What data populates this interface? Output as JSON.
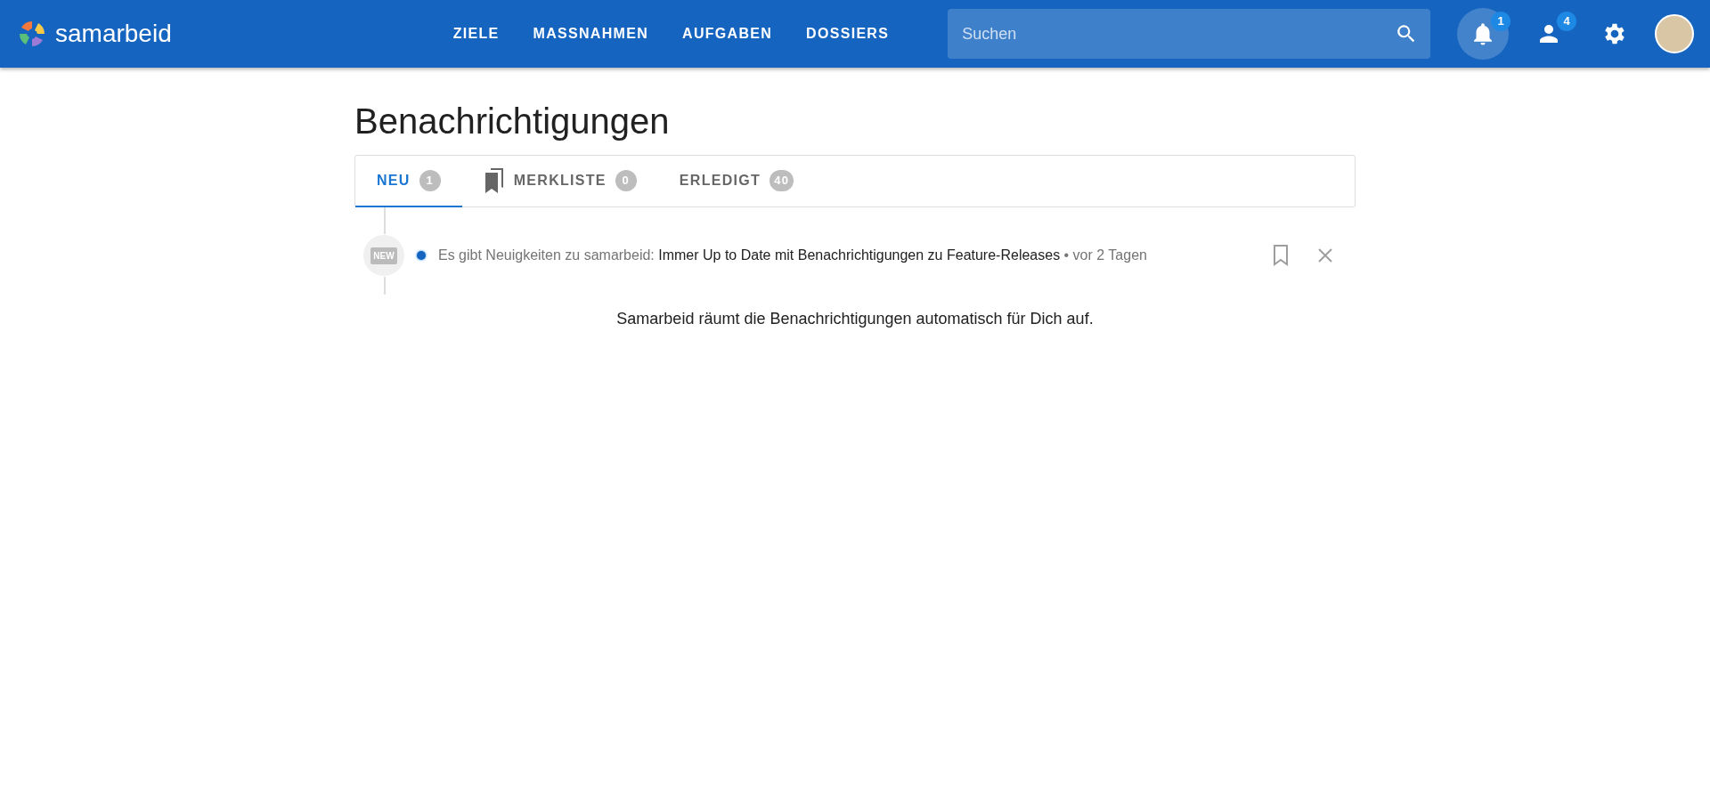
{
  "app": {
    "name": "samarbeid"
  },
  "nav": [
    {
      "label": "ZIELE"
    },
    {
      "label": "MASSNAHMEN"
    },
    {
      "label": "AUFGABEN"
    },
    {
      "label": "DOSSIERS"
    }
  ],
  "search": {
    "placeholder": "Suchen"
  },
  "header_actions": [
    {
      "kind": "notifications",
      "badge": "1",
      "selected": true
    },
    {
      "kind": "people",
      "badge": "4",
      "selected": false
    },
    {
      "kind": "settings",
      "selected": false
    },
    {
      "kind": "avatar",
      "selected": false
    }
  ],
  "page": {
    "title": "Benachrichtigungen"
  },
  "tabs": [
    {
      "label": "NEU",
      "count": "1",
      "kind": "plain",
      "selected": true
    },
    {
      "label": "MERKLISTE",
      "count": "0",
      "kind": "bookmarks",
      "selected": false
    },
    {
      "label": "ERLEDIGT",
      "count": "40",
      "kind": "plain",
      "selected": false
    }
  ],
  "notifications": [
    {
      "icon_text": "NEW",
      "unread": true,
      "prefix": "Es gibt Neuigkeiten zu samarbeid:",
      "subject": "Immer Up to Date mit Benachrichtigungen zu Feature-Releases",
      "time": "• vor 2 Tagen",
      "bookmarked": false
    }
  ],
  "footer_note": "Samarbeid räumt die Benachrichtigungen automatisch für Dich auf."
}
